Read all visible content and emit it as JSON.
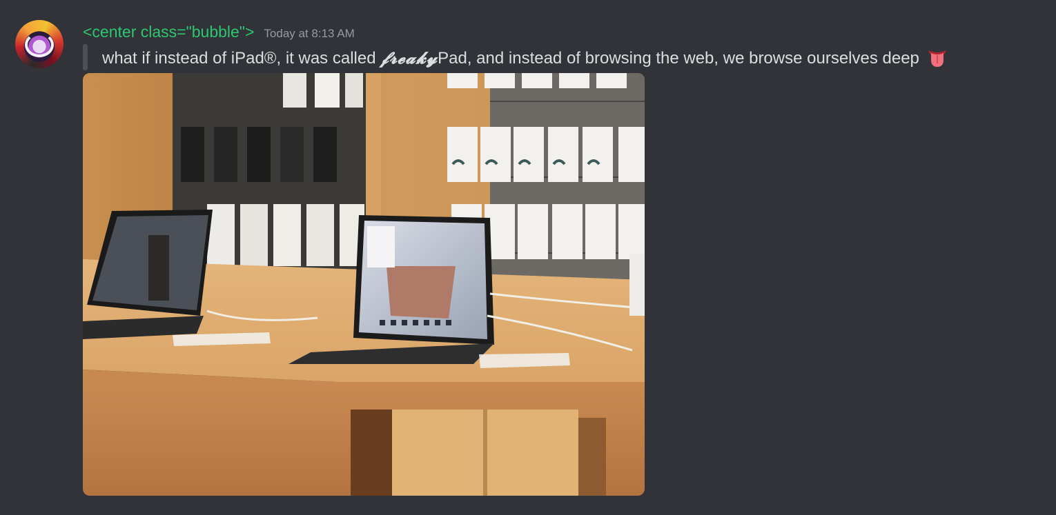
{
  "message": {
    "username": "<center class=\"bubble\">",
    "timestamp": "Today at 8:13 AM",
    "text_before": "what if instead of iPad®, it was called ",
    "stylized_word": "𝓯𝓻𝓮𝓪𝓴𝔂",
    "text_after": "Pad, and instead of browsing the web, we browse ourselves deep",
    "emoji": "tongue-emoji"
  },
  "attachment": {
    "type": "photo"
  },
  "colors": {
    "background": "#313338",
    "username": "#2dc770",
    "timestamp": "#949ba4",
    "text": "#dbdee1",
    "quote_bar": "#4e5058"
  }
}
